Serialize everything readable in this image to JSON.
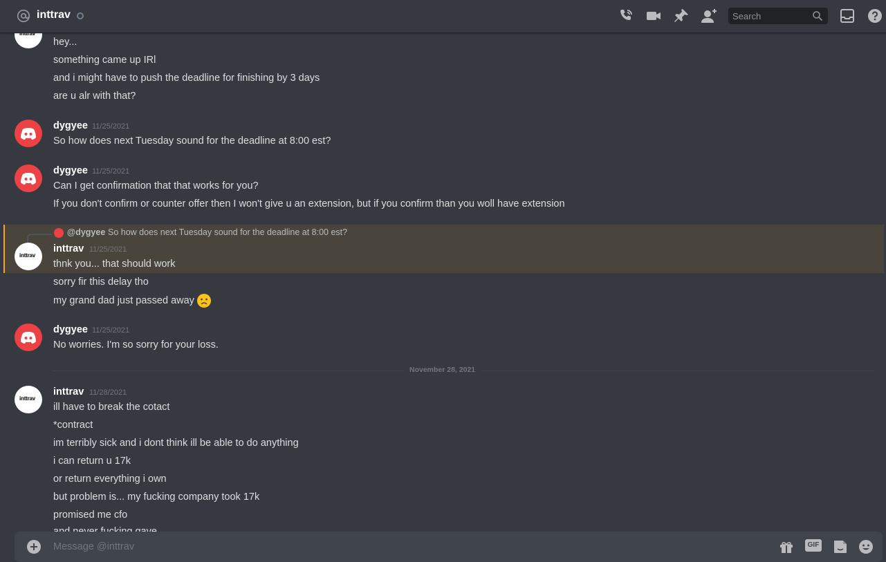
{
  "header": {
    "channel_name": "inttrav",
    "search_placeholder": "Search"
  },
  "messages": [
    {
      "lines": [
        "hey...",
        "something came up IRl",
        "and i might have to push the deadline for finishing by 3 days",
        "are u alr with that?"
      ],
      "avatar_text": "inttrav"
    },
    {
      "username": "dygyee",
      "timestamp": "11/25/2021",
      "lines": [
        "So how does next Tuesday sound for the deadline at 8:00 est?"
      ]
    },
    {
      "username": "dygyee",
      "timestamp": "11/25/2021",
      "lines": [
        "Can I get confirmation that that works for you?",
        "If you don't confirm or counter offer then I won't give u an extension, but if you confirm than you woll have extension"
      ]
    },
    {
      "reply_to": "@dygyee",
      "reply_text": "So how does next Tuesday sound for the deadline at 8:00 est?",
      "username": "inttrav",
      "timestamp": "11/25/2021",
      "avatar_text": "inttrav",
      "lines": [
        "thnk you... that should work",
        "sorry fir this delay tho",
        "my grand dad just passed away"
      ]
    },
    {
      "username": "dygyee",
      "timestamp": "11/25/2021",
      "lines": [
        "No worries. I'm so sorry for your loss."
      ]
    },
    {
      "username": "inttrav",
      "timestamp": "11/28/2021",
      "avatar_text": "inttrav",
      "lines": [
        "ill have to break the cotact",
        "*contract",
        "im terribly sick and i dont think ill be able to do anything",
        "i can return u 17k",
        "or return everything i own",
        "but problem is... my fucking company took 17k",
        "promised me cfo",
        "and never fucking gave"
      ]
    }
  ],
  "date_divider": "November 28, 2021",
  "composer": {
    "placeholder": "Message @inttrav",
    "gif_label": "GIF"
  },
  "colors": {
    "background": "#36393f",
    "header_border": "#202225",
    "mention_highlight": "#49443c",
    "mention_bar": "#faa81a",
    "discord_red": "#ed4245",
    "composer_bg": "#40444b"
  },
  "icons": [
    "at-icon",
    "status-icon",
    "voice-call-icon",
    "video-call-icon",
    "pin-icon",
    "add-friend-icon",
    "search-icon",
    "inbox-icon",
    "help-icon",
    "add-attachment-icon",
    "gift-icon",
    "gif-icon",
    "sticker-icon",
    "emoji-icon",
    "discord-logo-icon",
    "sad-face-emoji"
  ]
}
